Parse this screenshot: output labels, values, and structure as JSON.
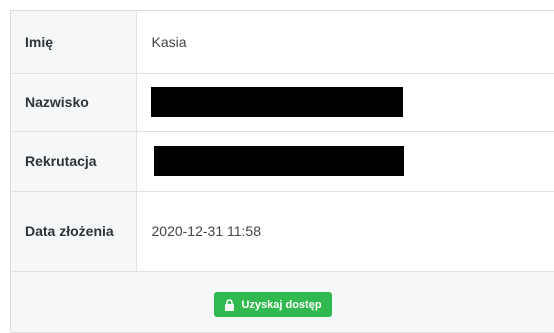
{
  "fields": [
    {
      "label": "Imię",
      "value": "Kasia"
    },
    {
      "label": "Nazwisko",
      "value": ""
    },
    {
      "label": "Rekrutacja",
      "value": ""
    },
    {
      "label": "Data złożenia",
      "value": "2020-12-31 11:58"
    }
  ],
  "action": {
    "button_label": "Uzyskaj dostęp",
    "icon": "lock-icon",
    "color": "#2fb94e"
  }
}
